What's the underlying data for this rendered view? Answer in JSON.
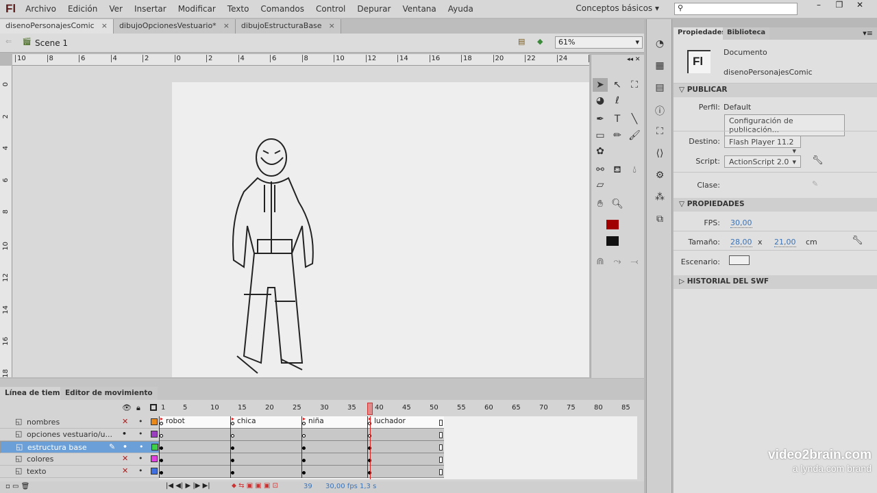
{
  "app": {
    "logo": "Fl"
  },
  "menu": [
    "Archivo",
    "Edición",
    "Ver",
    "Insertar",
    "Modificar",
    "Texto",
    "Comandos",
    "Control",
    "Depurar",
    "Ventana",
    "Ayuda"
  ],
  "workspace": "Conceptos básicos ▾",
  "search": {
    "placeholder": "",
    "icon": "search-icon"
  },
  "window_controls": [
    "–",
    "❐",
    "✕"
  ],
  "doc_tabs": [
    {
      "label": "disenoPersonajesComic",
      "active": true
    },
    {
      "label": "dibujoOpcionesVestuario*",
      "active": false
    },
    {
      "label": "dibujoEstructuraBase",
      "active": false
    }
  ],
  "scene": {
    "label": "Scene 1",
    "zoom": "61%"
  },
  "rulers": {
    "h": [
      "10",
      "8",
      "6",
      "4",
      "2",
      "0",
      "2",
      "4",
      "6",
      "8",
      "10",
      "12",
      "14",
      "16",
      "18",
      "20",
      "22",
      "24",
      "2"
    ],
    "v": [
      "0",
      "2",
      "4",
      "6",
      "8",
      "10",
      "12",
      "14",
      "16",
      "18"
    ]
  },
  "properties": {
    "tabs": [
      "Propiedades",
      "Biblioteca"
    ],
    "doc_type": "Documento",
    "doc_name": "disenoPersonajesComic",
    "doc_icon": "Fl",
    "publicar": {
      "title": "PUBLICAR",
      "perfil_label": "Perfil:",
      "perfil": "Default",
      "config_button": "Configuración de publicación...",
      "destino_label": "Destino:",
      "destino": "Flash Player 11.2",
      "script_label": "Script:",
      "script": "ActionScript 2.0",
      "clase_label": "Clase:"
    },
    "propiedades": {
      "title": "PROPIEDADES",
      "fps_label": "FPS:",
      "fps": "30,00",
      "size_label": "Tamaño:",
      "width": "28,00",
      "x": "x",
      "height": "21,00",
      "unit": "cm",
      "stage_label": "Escenario:",
      "stage_color": "#f0f0f0"
    },
    "historial": "HISTORIAL DEL SWF"
  },
  "timeline": {
    "tabs": [
      "Línea de tiempo",
      "Editor de movimiento"
    ],
    "ticks": [
      "1",
      "5",
      "10",
      "15",
      "20",
      "25",
      "30",
      "35",
      "40",
      "45",
      "50",
      "55",
      "60",
      "65",
      "70",
      "75",
      "80",
      "85"
    ],
    "current_frame": 39,
    "layers": [
      {
        "name": "nombres",
        "hidden": true,
        "color": "#e8891a",
        "selected": false
      },
      {
        "name": "opciones vestuario/u...",
        "hidden": false,
        "color": "#9b3fc0",
        "selected": false
      },
      {
        "name": "estructura base",
        "hidden": false,
        "color": "#3fd04a",
        "selected": true
      },
      {
        "name": "colores",
        "hidden": true,
        "color": "#e040e0",
        "selected": false
      },
      {
        "name": "texto",
        "hidden": true,
        "color": "#3f6fe0",
        "selected": false
      }
    ],
    "labels": [
      {
        "frame": 2,
        "text": "robot"
      },
      {
        "frame": 15,
        "text": "chica"
      },
      {
        "frame": 28,
        "text": "niña"
      },
      {
        "frame": 40,
        "text": "luchador"
      }
    ],
    "keyframes": [
      1,
      14,
      27,
      39
    ],
    "last_frame": 52,
    "status": {
      "frame": "39",
      "fps": "30,00 fps",
      "time": "1,3 s"
    }
  },
  "watermark": {
    "line1": "video2brain.com",
    "line2": "a lynda.com brand"
  }
}
